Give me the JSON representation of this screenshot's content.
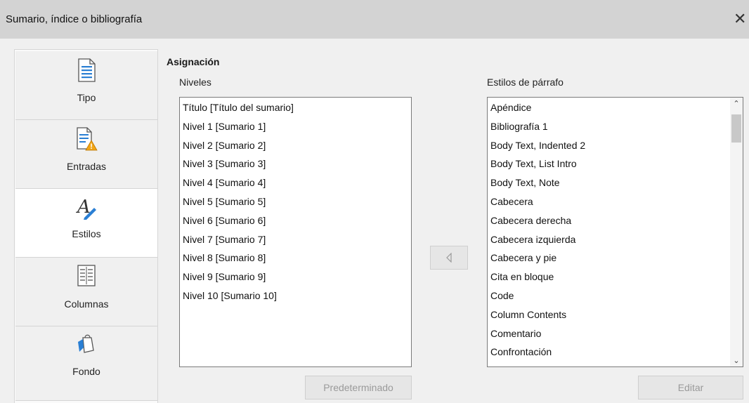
{
  "window": {
    "title": "Sumario, índice o bibliografía",
    "close_symbol": "✕"
  },
  "sidebar": {
    "tabs": [
      {
        "label": "Tipo",
        "icon": "document-icon"
      },
      {
        "label": "Entradas",
        "icon": "document-warning-icon"
      },
      {
        "label": "Estilos",
        "icon": "styles-icon"
      },
      {
        "label": "Columnas",
        "icon": "columns-icon"
      },
      {
        "label": "Fondo",
        "icon": "paint-bucket-icon"
      }
    ],
    "active_tab": "Estilos"
  },
  "assignment": {
    "heading": "Asignación",
    "levels_label": "Niveles",
    "levels": [
      "Título [Título del sumario]",
      "Nivel 1 [Sumario 1]",
      "Nivel 2 [Sumario 2]",
      "Nivel 3 [Sumario 3]",
      "Nivel 4 [Sumario 4]",
      "Nivel 5 [Sumario 5]",
      "Nivel 6 [Sumario 6]",
      "Nivel 7 [Sumario 7]",
      "Nivel 8 [Sumario 8]",
      "Nivel 9 [Sumario 9]",
      "Nivel 10 [Sumario 10]"
    ],
    "styles_label": "Estilos de párrafo",
    "styles": [
      "Apéndice",
      "Bibliografía 1",
      "Body Text, Indented 2",
      "Body Text, List Intro",
      "Body Text, Note",
      "Cabecera",
      "Cabecera derecha",
      "Cabecera izquierda",
      "Cabecera y pie",
      "Cita en bloque",
      "Code",
      "Column Contents",
      "Comentario",
      "Confrontación"
    ],
    "assign_button_icon": "left-arrow-icon",
    "default_button": "Predeterminado",
    "edit_button": "Editar"
  },
  "colors": {
    "titlebar": "#d3d3d3",
    "background": "#f0f0f0",
    "disabled_text": "#9a9a9a"
  }
}
